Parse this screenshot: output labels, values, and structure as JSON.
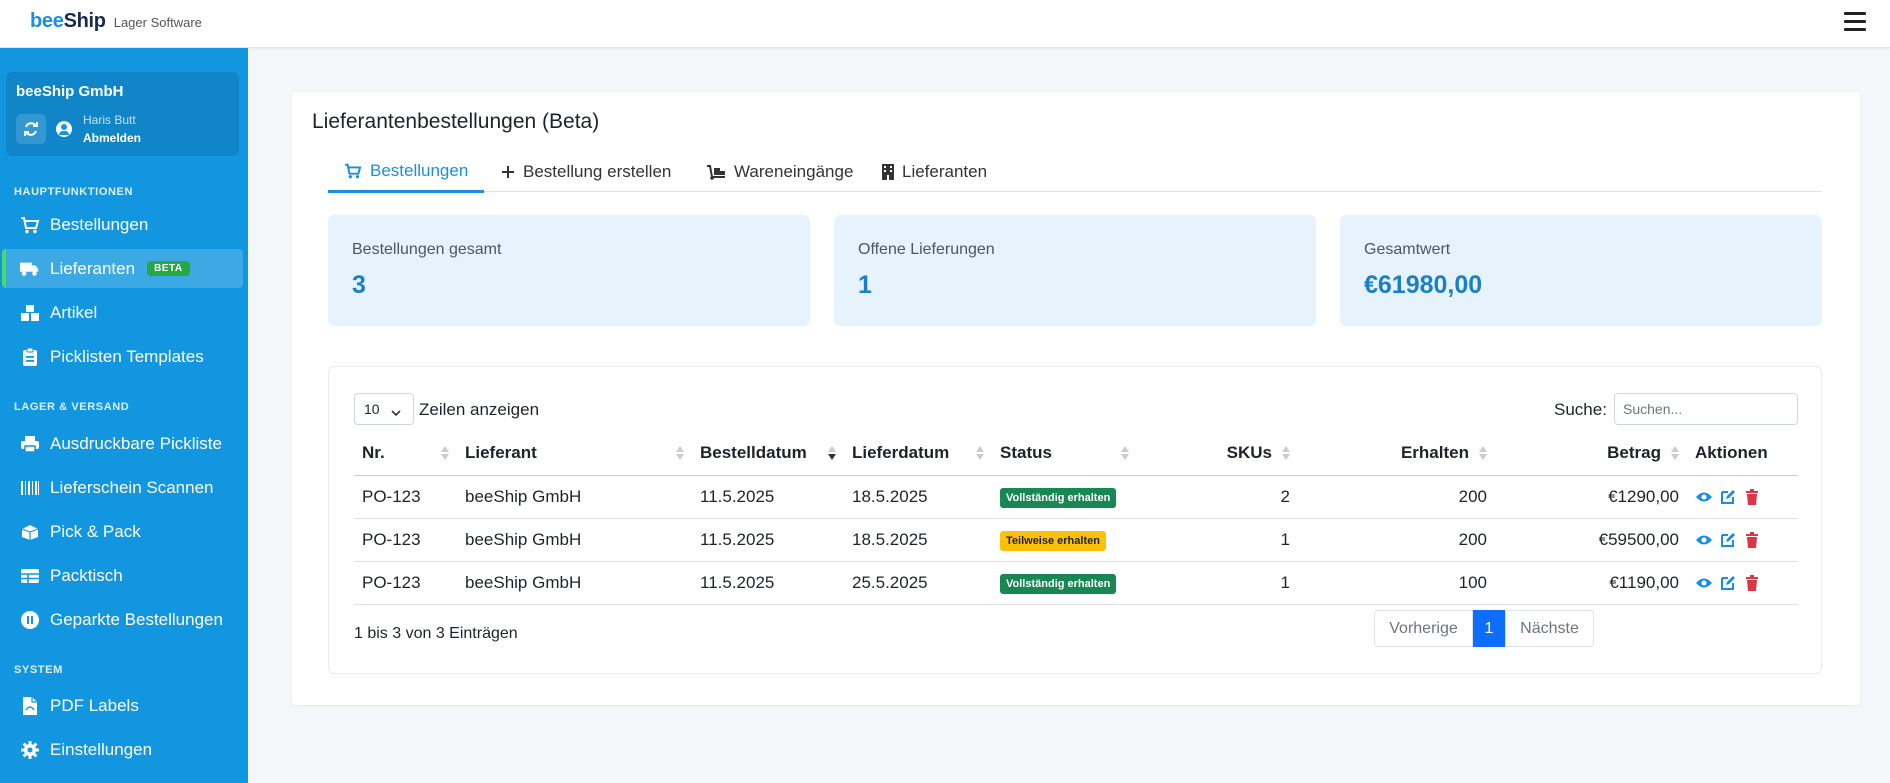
{
  "brand": {
    "part1": "bee",
    "part2": "Ship",
    "subtitle": "Lager Software"
  },
  "account": {
    "company": "beeShip GmbH",
    "user": "Haris Butt",
    "logout": "Abmelden"
  },
  "sidebar": {
    "sections": [
      "HAUPTFUNKTIONEN",
      "LAGER & VERSAND",
      "SYSTEM"
    ],
    "items": [
      {
        "label": "Bestellungen",
        "icon": "cart-icon"
      },
      {
        "label": "Lieferanten",
        "icon": "truck-icon",
        "badge": "BETA",
        "active": true
      },
      {
        "label": "Artikel",
        "icon": "boxes-icon"
      },
      {
        "label": "Picklisten Templates",
        "icon": "clipboard-icon"
      },
      {
        "label": "Ausdruckbare Pickliste",
        "icon": "printer-icon"
      },
      {
        "label": "Lieferschein Scannen",
        "icon": "barcode-icon"
      },
      {
        "label": "Pick & Pack",
        "icon": "box-icon"
      },
      {
        "label": "Packtisch",
        "icon": "table-icon"
      },
      {
        "label": "Geparkte Bestellungen",
        "icon": "pause-icon"
      },
      {
        "label": "PDF Labels",
        "icon": "pdf-icon"
      },
      {
        "label": "Einstellungen",
        "icon": "gear-icon"
      }
    ]
  },
  "page": {
    "title": "Lieferantenbestellungen (Beta)"
  },
  "tabs": [
    {
      "label": "Bestellungen",
      "icon": "cart-icon",
      "active": true
    },
    {
      "label": "Bestellung erstellen",
      "icon": "plus-icon"
    },
    {
      "label": "Wareneingänge",
      "icon": "dolly-icon"
    },
    {
      "label": "Lieferanten",
      "icon": "building-icon"
    }
  ],
  "stats": [
    {
      "label": "Bestellungen gesamt",
      "value": "3"
    },
    {
      "label": "Offene Lieferungen",
      "value": "1"
    },
    {
      "label": "Gesamtwert",
      "value": "€61980,00"
    }
  ],
  "table": {
    "length_value": "10",
    "length_label": "Zeilen anzeigen",
    "search_label": "Suche:",
    "search_placeholder": "Suchen...",
    "columns": [
      "Nr.",
      "Lieferant",
      "Bestelldatum",
      "Lieferdatum",
      "Status",
      "SKUs",
      "Erhalten",
      "Betrag",
      "Aktionen"
    ],
    "sorted_column": "Bestelldatum",
    "sort_direction": "desc",
    "rows": [
      {
        "nr": "PO-123",
        "supplier": "beeShip GmbH",
        "order_date": "11.5.2025",
        "delivery_date": "18.5.2025",
        "status": "Vollständig erhalten",
        "status_type": "complete",
        "skus": "2",
        "received": "200",
        "amount": "€1290,00"
      },
      {
        "nr": "PO-123",
        "supplier": "beeShip GmbH",
        "order_date": "11.5.2025",
        "delivery_date": "18.5.2025",
        "status": "Teilweise erhalten",
        "status_type": "partial",
        "skus": "1",
        "received": "200",
        "amount": "€59500,00"
      },
      {
        "nr": "PO-123",
        "supplier": "beeShip GmbH",
        "order_date": "11.5.2025",
        "delivery_date": "25.5.2025",
        "status": "Vollständig erhalten",
        "status_type": "complete",
        "skus": "1",
        "received": "100",
        "amount": "€1190,00"
      }
    ],
    "info": "1 bis 3 von 3 Einträgen",
    "pagination": {
      "prev": "Vorherige",
      "current": "1",
      "next": "Nächste"
    }
  },
  "colors": {
    "sidebar": "#1296e0",
    "accent": "#1a8fe0",
    "stat_bg": "#e6f3fc",
    "success": "#198754",
    "warning": "#ffc107",
    "danger": "#dc3545",
    "page_active": "#0d6efd"
  }
}
